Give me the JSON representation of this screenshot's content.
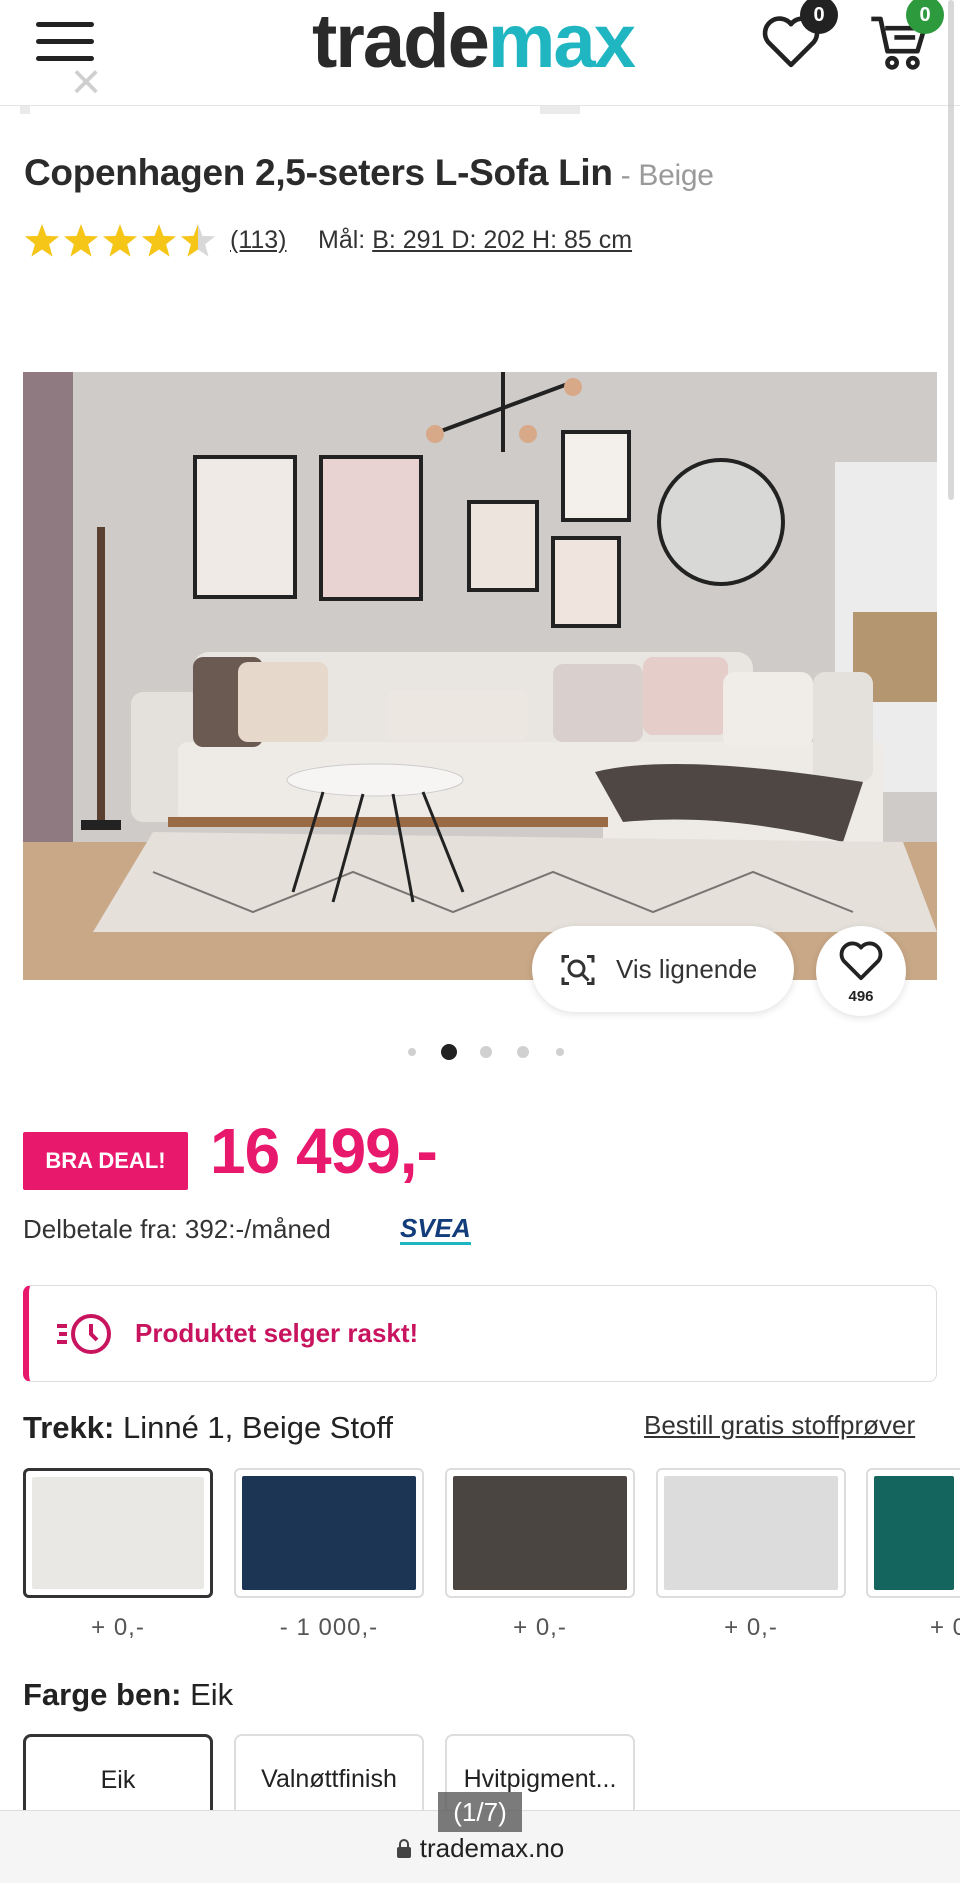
{
  "header": {
    "logo_part1": "trade",
    "logo_part2": "max",
    "wishlist_count": "0",
    "cart_count": "0"
  },
  "product": {
    "title": "Copenhagen 2,5-seters L-Sofa Lin",
    "variant": "- Beige",
    "rating": 4.5,
    "reviews": "(113)",
    "dims_label": "Mål:",
    "dims_value": "B: 291 D: 202 H: 85 cm"
  },
  "hero": {
    "similar_label": "Vis lignende",
    "favorites": "496",
    "dots_total": 5,
    "dots_active": 2
  },
  "price": {
    "deal_badge": "BRA DEAL!",
    "amount": "16 499,-",
    "installment": "Delbetale fra: 392:-/måned",
    "provider": "SVEA"
  },
  "alert": {
    "text": "Produktet selger raskt!"
  },
  "trekk": {
    "label": "Trekk:",
    "value": "Linné 1, Beige Stoff",
    "link": "Bestill gratis stoffprøver",
    "swatches": [
      {
        "color": "#e9e8e4",
        "price": "+ 0,-"
      },
      {
        "color": "#1d3554",
        "price": "- 1 000,-"
      },
      {
        "color": "#4b4542",
        "price": "+ 0,-"
      },
      {
        "color": "#dcdcdc",
        "price": "+ 0,-"
      },
      {
        "color": "#14655d",
        "price": "+ 0"
      }
    ]
  },
  "legs": {
    "label": "Farge ben:",
    "value": "Eik",
    "options": [
      "Eik",
      "Valnøttfinish",
      "Hvitpigment..."
    ]
  },
  "browser": {
    "url": "trademax.no",
    "pager": "(1/7)"
  },
  "colors": {
    "accent_pink": "#e8186d",
    "brand_teal": "#1fb6c2",
    "star": "#f5c518"
  }
}
